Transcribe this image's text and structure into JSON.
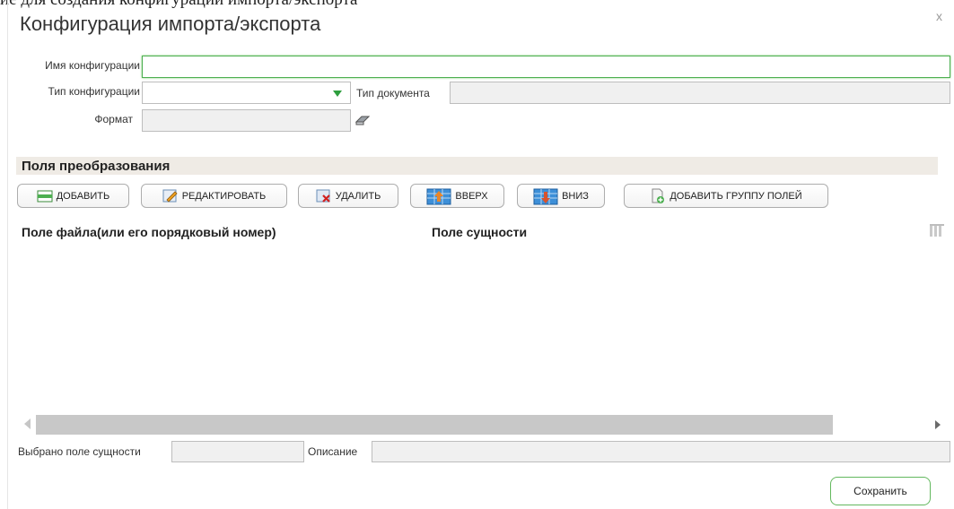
{
  "background_caption": "ие для создания конфигурации импорта/экспорта",
  "dialog": {
    "title": "Конфигурация импорта/экспорта",
    "close_label": "x"
  },
  "form": {
    "config_name_label": "Имя конфигурации",
    "config_name_value": "",
    "config_type_label": "Тип конфигурации",
    "config_type_value": "",
    "doc_type_label": "Тип документа",
    "doc_type_value": "",
    "format_label": "Формат",
    "format_value": ""
  },
  "section": {
    "title": "Поля преобразования"
  },
  "toolbar": {
    "add_label": "ДОБАВИТЬ",
    "edit_label": "РЕДАКТИРОВАТЬ",
    "delete_label": "УДАЛИТЬ",
    "up_label": "ВВЕРХ",
    "down_label": "ВНИЗ",
    "add_group_label": "ДОБАВИТЬ ГРУППУ ПОЛЕЙ"
  },
  "table": {
    "columns": [
      "Поле файла(или его порядковый номер)",
      "Поле сущности"
    ],
    "rows": []
  },
  "footer": {
    "selected_field_label": "Выбрано поле сущности",
    "selected_field_value": "",
    "description_label": "Описание",
    "description_value": "",
    "save_label": "Сохранить"
  },
  "icons": [
    "add-icon",
    "edit-icon",
    "delete-icon",
    "move-up-icon",
    "move-down-icon",
    "add-group-icon",
    "eraser-icon",
    "columns-icon",
    "close-icon"
  ],
  "colors": {
    "accent_green": "#4caf50",
    "section_bg": "#efebe5",
    "field_bg": "#f0f0f0"
  }
}
